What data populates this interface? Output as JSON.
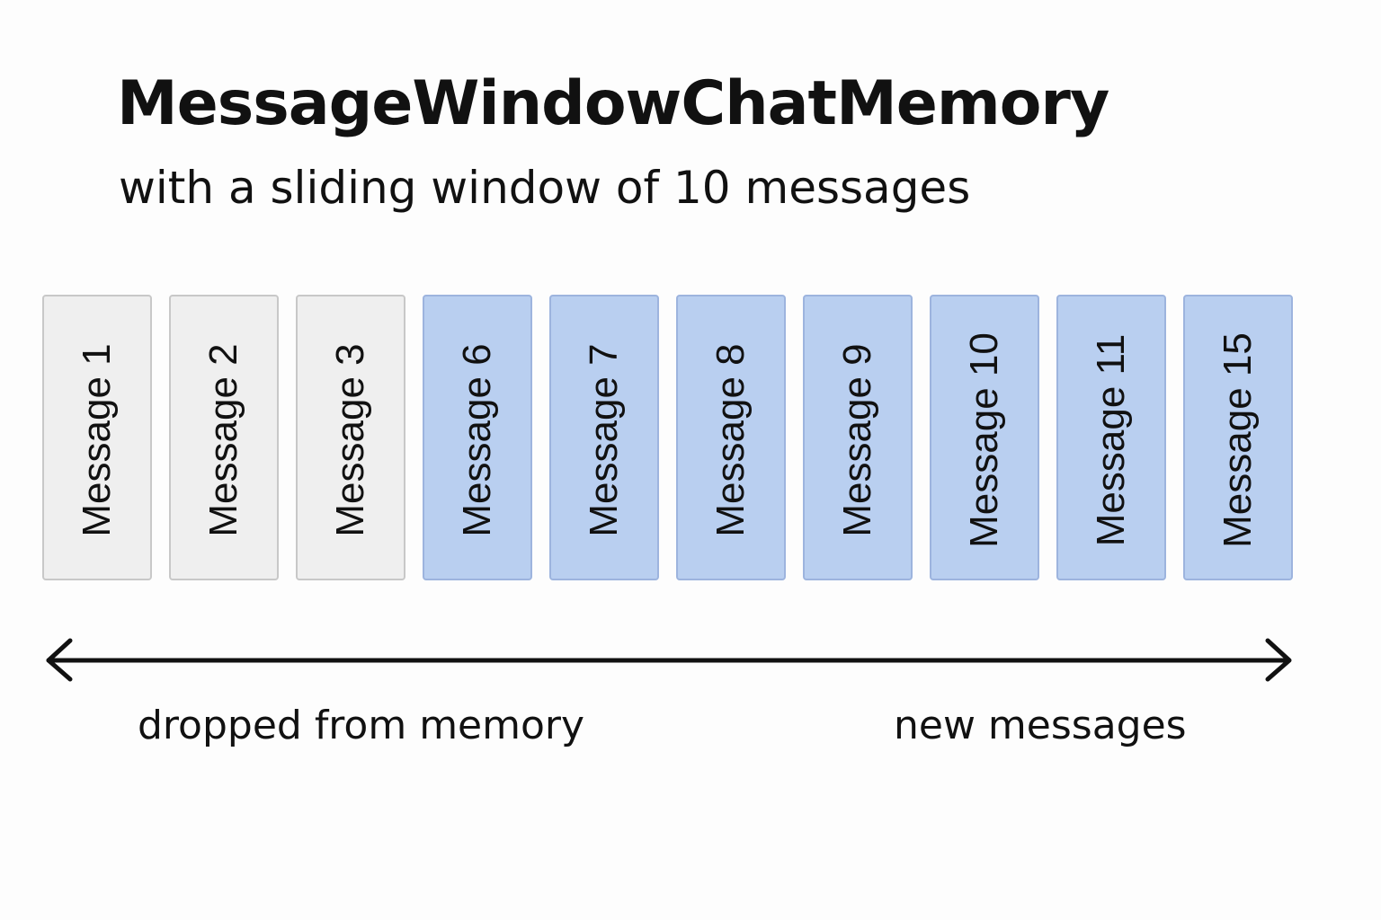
{
  "title": "MessageWindowChatMemory",
  "subtitle": "with a sliding window of 10 messages",
  "messages": [
    {
      "label": "Message 1",
      "state": "dropped"
    },
    {
      "label": "Message 2",
      "state": "dropped"
    },
    {
      "label": "Message 3",
      "state": "dropped"
    },
    {
      "label": "Message 6",
      "state": "kept"
    },
    {
      "label": "Message 7",
      "state": "kept"
    },
    {
      "label": "Message 8",
      "state": "kept"
    },
    {
      "label": "Message 9",
      "state": "kept"
    },
    {
      "label": "Message 10",
      "state": "kept"
    },
    {
      "label": "Message 11",
      "state": "kept"
    },
    {
      "label": "Message 15",
      "state": "kept"
    }
  ],
  "captions": {
    "left": "dropped from memory",
    "right": "new messages"
  },
  "colors": {
    "dropped_fill": "#efefef",
    "dropped_border": "#c8c8c8",
    "kept_fill": "#b9cff0",
    "kept_border": "#9db4de",
    "arrow": "#111111"
  },
  "icons": {
    "arrow": "double-headed-arrow"
  }
}
